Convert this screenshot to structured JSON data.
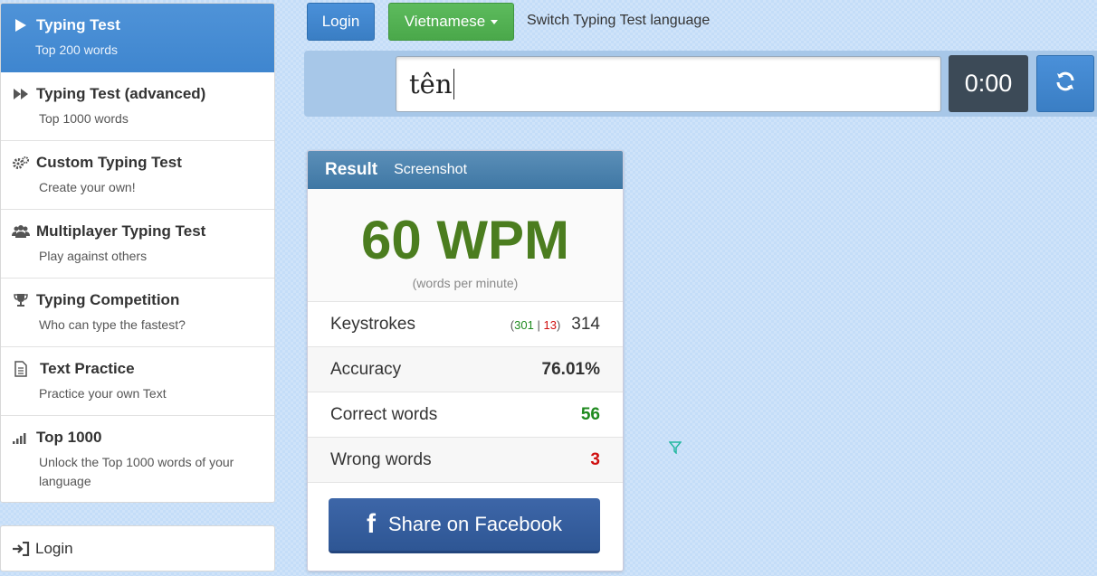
{
  "sidebar": {
    "items": [
      {
        "title": "Typing Test",
        "sub": "Top 200 words",
        "icon": "play-icon"
      },
      {
        "title": "Typing Test (advanced)",
        "sub": "Top 1000 words",
        "icon": "fast-forward-icon"
      },
      {
        "title": "Custom Typing Test",
        "sub": "Create your own!",
        "icon": "gears-icon"
      },
      {
        "title": "Multiplayer Typing Test",
        "sub": "Play against others",
        "icon": "users-icon"
      },
      {
        "title": "Typing Competition",
        "sub": "Who can type the fastest?",
        "icon": "trophy-icon"
      },
      {
        "title": "Text Practice",
        "sub": "Practice your own Text",
        "icon": "document-icon"
      },
      {
        "title": "Top 1000",
        "sub": "Unlock the Top 1000 words of your language",
        "icon": "signal-bars-icon"
      }
    ],
    "login_label": "Login"
  },
  "topbar": {
    "login_label": "Login",
    "language_label": "Vietnamese",
    "switch_label": "Switch Typing Test language"
  },
  "typing": {
    "input_value": "tên",
    "timer": "0:00"
  },
  "result": {
    "title": "Result",
    "screenshot_label": "Screenshot",
    "wpm": "60 WPM",
    "wpm_sub": "(words per minute)",
    "keystrokes_label": "Keystrokes",
    "keystrokes_correct": "301",
    "keystrokes_sep": "|",
    "keystrokes_wrong": "13",
    "keystrokes_total": "314",
    "accuracy_label": "Accuracy",
    "accuracy_value": "76.01%",
    "correct_label": "Correct words",
    "correct_value": "56",
    "wrong_label": "Wrong words",
    "wrong_value": "3",
    "facebook_label": "Share on Facebook"
  },
  "colors": {
    "active_blue": "#4a8fd5",
    "wpm_green": "#4b7d1f",
    "correct_green": "#1f8a1f",
    "wrong_red": "#d01010",
    "facebook_blue": "#3b5998"
  }
}
